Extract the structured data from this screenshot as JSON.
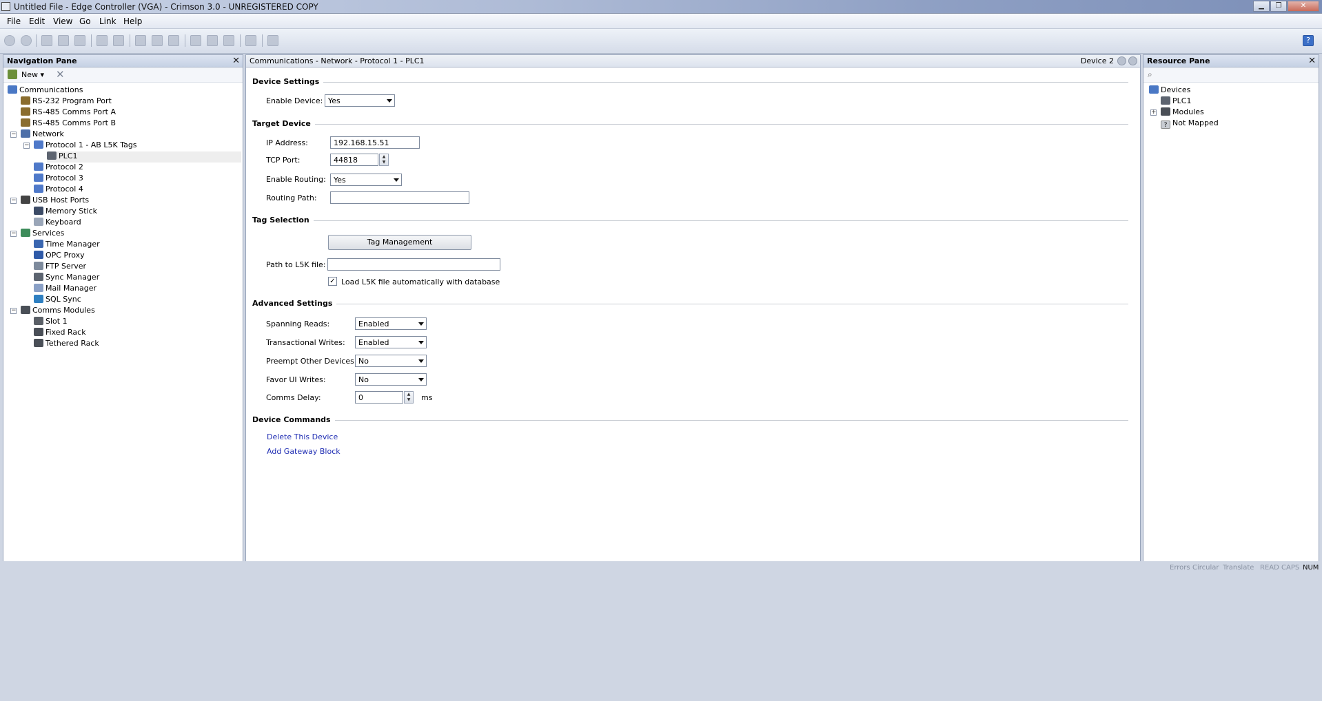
{
  "window": {
    "title": "Untitled File - Edge Controller (VGA) - Crimson 3.0 - UNREGISTERED COPY"
  },
  "menu": [
    "File",
    "Edit",
    "View",
    "Go",
    "Link",
    "Help"
  ],
  "toolbar": {
    "icons": [
      "back-icon",
      "forward-icon",
      "new-file-icon",
      "open-icon",
      "save-icon",
      "import-icon",
      "export-icon",
      "cut-icon",
      "copy-icon",
      "paste-icon",
      "find-icon",
      "print-icon",
      "link-icon",
      "monitor-icon",
      "wrench-icon",
      "help-icon"
    ]
  },
  "navigation": {
    "title": "Navigation Pane",
    "new_label": "New",
    "tree": [
      {
        "label": "Communications",
        "level": 0,
        "icon": "comms-icon",
        "expander": ""
      },
      {
        "label": "RS-232 Program Port",
        "level": 1,
        "icon": "serial-port-icon",
        "expander": ""
      },
      {
        "label": "RS-485 Comms Port A",
        "level": 1,
        "icon": "serial-port-icon",
        "expander": ""
      },
      {
        "label": "RS-485 Comms Port B",
        "level": 1,
        "icon": "serial-port-icon",
        "expander": ""
      },
      {
        "label": "Network",
        "level": 1,
        "icon": "network-icon",
        "expander": "−"
      },
      {
        "label": "Protocol 1 - AB L5K Tags",
        "level": 2,
        "icon": "protocol-icon",
        "expander": "−"
      },
      {
        "label": "PLC1",
        "level": 3,
        "icon": "plc-icon",
        "expander": "",
        "selected": true
      },
      {
        "label": "Protocol 2",
        "level": 2,
        "icon": "protocol-icon",
        "expander": ""
      },
      {
        "label": "Protocol 3",
        "level": 2,
        "icon": "protocol-icon",
        "expander": ""
      },
      {
        "label": "Protocol 4",
        "level": 2,
        "icon": "protocol-icon",
        "expander": ""
      },
      {
        "label": "USB Host Ports",
        "level": 1,
        "icon": "usb-icon",
        "expander": "−"
      },
      {
        "label": "Memory Stick",
        "level": 2,
        "icon": "memory-stick-icon",
        "expander": ""
      },
      {
        "label": "Keyboard",
        "level": 2,
        "icon": "keyboard-icon",
        "expander": ""
      },
      {
        "label": "Services",
        "level": 1,
        "icon": "services-icon",
        "expander": "−"
      },
      {
        "label": "Time Manager",
        "level": 2,
        "icon": "clock-icon",
        "expander": ""
      },
      {
        "label": "OPC Proxy",
        "level": 2,
        "icon": "opc-icon",
        "expander": ""
      },
      {
        "label": "FTP Server",
        "level": 2,
        "icon": "ftp-icon",
        "expander": ""
      },
      {
        "label": "Sync Manager",
        "level": 2,
        "icon": "sync-icon",
        "expander": ""
      },
      {
        "label": "Mail Manager",
        "level": 2,
        "icon": "mail-icon",
        "expander": ""
      },
      {
        "label": "SQL Sync",
        "level": 2,
        "icon": "sql-icon",
        "expander": ""
      },
      {
        "label": "Comms Modules",
        "level": 1,
        "icon": "modules-icon",
        "expander": "−"
      },
      {
        "label": "Slot 1",
        "level": 2,
        "icon": "slot-icon",
        "expander": ""
      },
      {
        "label": "Fixed Rack",
        "level": 2,
        "icon": "rack-icon",
        "expander": ""
      },
      {
        "label": "Tethered Rack",
        "level": 2,
        "icon": "rack-icon",
        "expander": ""
      }
    ]
  },
  "content": {
    "breadcrumb": "Communications - Network - Protocol 1 - PLC1",
    "device_nav": "Device 2",
    "sections": {
      "device_settings": "Device Settings",
      "target_device": "Target Device",
      "tag_selection": "Tag Selection",
      "advanced_settings": "Advanced Settings",
      "device_commands": "Device Commands"
    },
    "fields": {
      "enable_device": {
        "label": "Enable Device:",
        "value": "Yes"
      },
      "ip_address": {
        "label": "IP Address:",
        "value": "192.168.15.51"
      },
      "tcp_port": {
        "label": "TCP Port:",
        "value": "44818"
      },
      "enable_routing": {
        "label": "Enable Routing:",
        "value": "Yes"
      },
      "routing_path": {
        "label": "Routing Path:",
        "value": ""
      },
      "tag_management": "Tag Management",
      "l5k_path": {
        "label": "Path to L5K file:",
        "value": ""
      },
      "load_l5k": {
        "label": "Load L5K file automatically with database",
        "checked": "✓"
      },
      "spanning_reads": {
        "label": "Spanning Reads:",
        "value": "Enabled"
      },
      "transactional_writes": {
        "label": "Transactional Writes:",
        "value": "Enabled"
      },
      "preempt": {
        "label": "Preempt Other Devices:",
        "value": "No"
      },
      "favor_ui": {
        "label": "Favor UI Writes:",
        "value": "No"
      },
      "comms_delay": {
        "label": "Comms Delay:",
        "value": "0",
        "unit": "ms"
      }
    },
    "commands": [
      "Delete This Device",
      "Add Gateway Block"
    ]
  },
  "resource": {
    "title": "Resource Pane",
    "tree": [
      {
        "label": "Devices",
        "level": 0,
        "icon": "devices-icon",
        "expander": ""
      },
      {
        "label": "PLC1",
        "level": 1,
        "icon": "plc-icon",
        "expander": ""
      },
      {
        "label": "Modules",
        "level": 1,
        "icon": "modules-icon",
        "expander": "+"
      },
      {
        "label": "Not Mapped",
        "level": 1,
        "icon": "question-icon",
        "expander": ""
      }
    ]
  },
  "status": [
    "Errors",
    "Circular",
    "Translate",
    "READ",
    "CAPS",
    "NUM"
  ],
  "colors": {
    "accent": "#1f2db3",
    "pane_header": "#c6d1e4"
  }
}
